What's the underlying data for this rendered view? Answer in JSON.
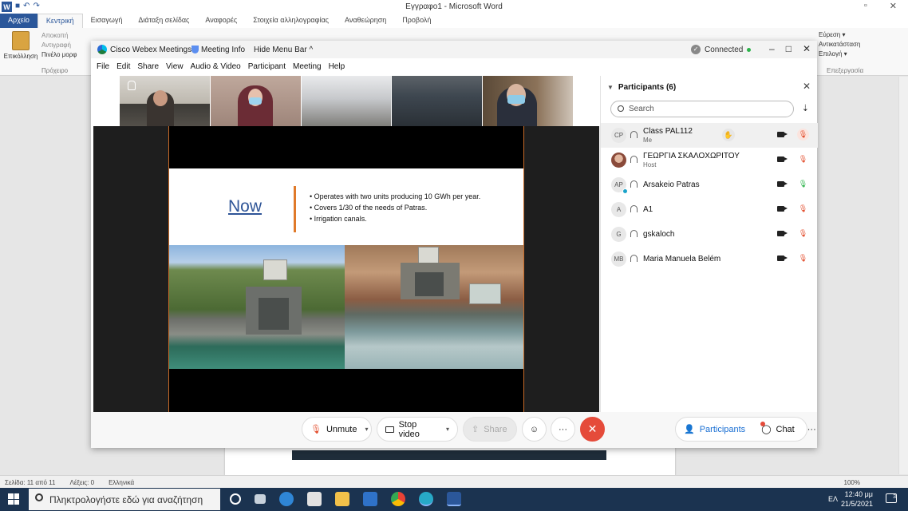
{
  "word": {
    "title": "Εγγραφο1 - Microsoft Word",
    "tabs": [
      "Αρχείο",
      "Κεντρική",
      "Εισαγωγή",
      "Διάταξη σελίδας",
      "Αναφορές",
      "Στοιχεία αλληλογραφίας",
      "Αναθεώρηση",
      "Προβολή"
    ],
    "clipboard": {
      "paste": "Επικόλληση",
      "cut": "Αποκοπή",
      "copy": "Αντιγραφή",
      "painter": "Πινέλο μορφ",
      "group": "Πρόχειρο"
    },
    "editing": {
      "find": "Εύρεση ▾",
      "replace": "Αντικατάσταση",
      "select": "Επιλογή ▾",
      "group": "Επεξεργασία"
    },
    "status": {
      "page": "Σελίδα: 11 από 11",
      "words": "Λέξεις: 0",
      "lang": "Ελληνικά",
      "zoom": "100%"
    }
  },
  "taskbar": {
    "search_placeholder": "Πληκτρολογήστε εδώ για αναζήτηση",
    "lang": "ΕΛ",
    "time": "12:40 μμ",
    "date": "21/5/2021",
    "notifications": "3"
  },
  "webex": {
    "app_name": "Cisco Webex Meetings",
    "meeting_info": "Meeting Info",
    "hide_menu": "Hide Menu Bar ^",
    "connection": "Connected",
    "menu": [
      "File",
      "Edit",
      "Share",
      "View",
      "Audio & Video",
      "Participant",
      "Meeting",
      "Help"
    ],
    "slide": {
      "title": "Now",
      "bullets": [
        "Operates with two units producing 10 GWh per year.",
        "Covers 1/30 of the needs of Patras.",
        "Irrigation canals."
      ]
    },
    "participants": {
      "header": "Participants (6)",
      "search_placeholder": "Search",
      "list": [
        {
          "initials": "CP",
          "name": "Class PAL112",
          "role": "Me",
          "mic": "muted"
        },
        {
          "initials": "",
          "name": "ΓΕΩΡΓΙΑ ΣΚΑΛΟΧΩΡΙΤΟΥ",
          "role": "Host",
          "mic": "muted"
        },
        {
          "initials": "AP",
          "name": "Arsakeio Patras",
          "role": "",
          "mic": "live"
        },
        {
          "initials": "A",
          "name": "A1",
          "role": "",
          "mic": "muted"
        },
        {
          "initials": "G",
          "name": "gskaloch",
          "role": "",
          "mic": "muted"
        },
        {
          "initials": "MB",
          "name": "Maria Manuela Belém",
          "role": "",
          "mic": "muted"
        }
      ]
    },
    "controls": {
      "unmute": "Unmute",
      "stop_video": "Stop video",
      "share": "Share",
      "participants": "Participants",
      "chat": "Chat"
    },
    "colors": {
      "end_call": "#e54b3a",
      "muted_mic": "#e34c2b",
      "accent": "#1a6fd3"
    }
  }
}
